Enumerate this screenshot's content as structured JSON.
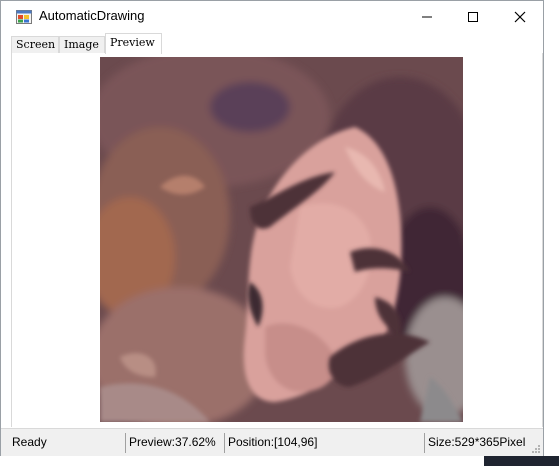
{
  "window": {
    "title": "AutomaticDrawing",
    "icon": "app-window-icon"
  },
  "controls": {
    "minimize_icon": "minimize-icon",
    "maximize_icon": "maximize-icon",
    "close_icon": "close-icon"
  },
  "tabs": [
    {
      "label": "Screen",
      "selected": false
    },
    {
      "label": "Image",
      "selected": false
    },
    {
      "label": "Preview",
      "selected": true
    }
  ],
  "preview": {
    "image": "painted-portrait-preview"
  },
  "status": {
    "state": "Ready",
    "preview": "Preview:37.62%",
    "position": "Position:[104,96]",
    "size": "Size:529*365Pixel"
  }
}
